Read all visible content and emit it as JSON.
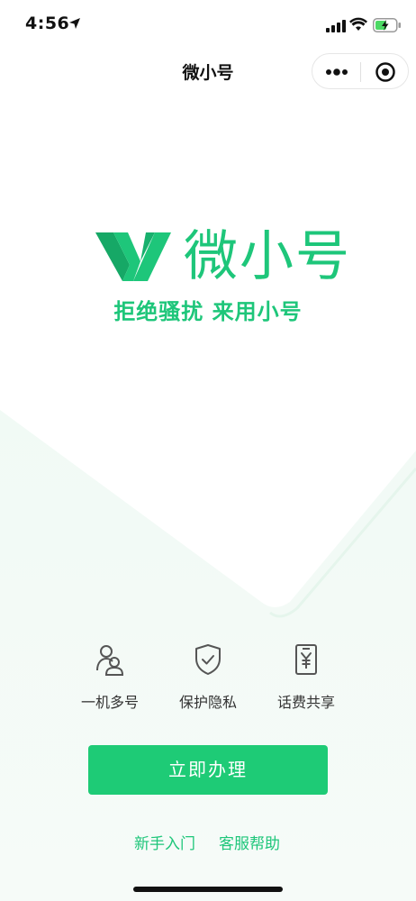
{
  "status_bar": {
    "time": "4:56"
  },
  "nav": {
    "title": "微小号"
  },
  "hero": {
    "brand_name": "微小号",
    "slogan": "拒绝骚扰 来用小号"
  },
  "features": [
    {
      "label": "一机多号",
      "icon": "users-icon"
    },
    {
      "label": "保护隐私",
      "icon": "shield-check-icon"
    },
    {
      "label": "话费共享",
      "icon": "yuan-phone-icon"
    }
  ],
  "actions": {
    "primary_button": "立即办理",
    "beginner_link": "新手入门",
    "support_link": "客服帮助"
  },
  "colors": {
    "brand_green": "#1ec67a",
    "button_green": "#1ecb76"
  }
}
